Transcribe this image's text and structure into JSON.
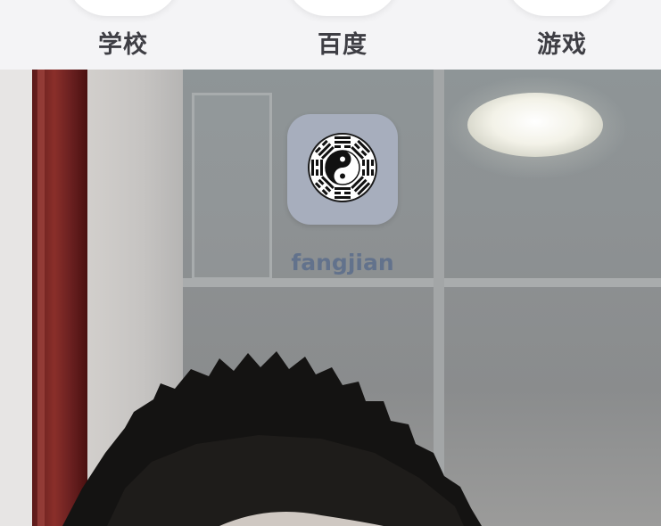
{
  "top_apps": [
    {
      "label": "学校",
      "icon": "app-icon"
    },
    {
      "label": "百度",
      "icon": "app-icon"
    },
    {
      "label": "游戏",
      "icon": "app-icon"
    }
  ],
  "shortcut": {
    "label": "fangjian",
    "icon": "yin-yang-bagua-icon",
    "tile_color": "#a7aebd"
  },
  "wallpaper": {
    "description_icon": "photo-wallpaper"
  }
}
